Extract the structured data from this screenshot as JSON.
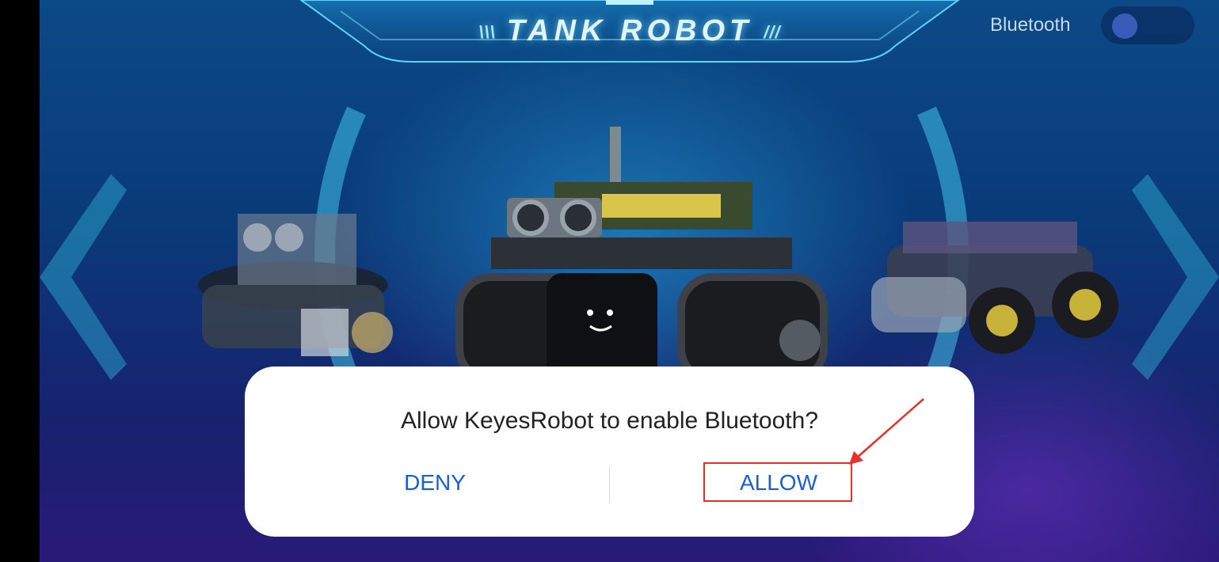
{
  "header": {
    "title": "TANK ROBOT",
    "deco_left": "\\\\\\",
    "deco_right": "///"
  },
  "bluetooth": {
    "label": "Bluetooth",
    "state": "off"
  },
  "carousel": {
    "robots": [
      "smart-robot-left",
      "tank-robot",
      "4wd-robot-right"
    ]
  },
  "dialog": {
    "message": "Allow KeyesRobot to enable Bluetooth?",
    "deny_label": "DENY",
    "allow_label": "ALLOW"
  },
  "colors": {
    "button_text": "#1a5fd0",
    "highlight": "#e8302a",
    "toggle_knob": "#3b5bb8"
  }
}
